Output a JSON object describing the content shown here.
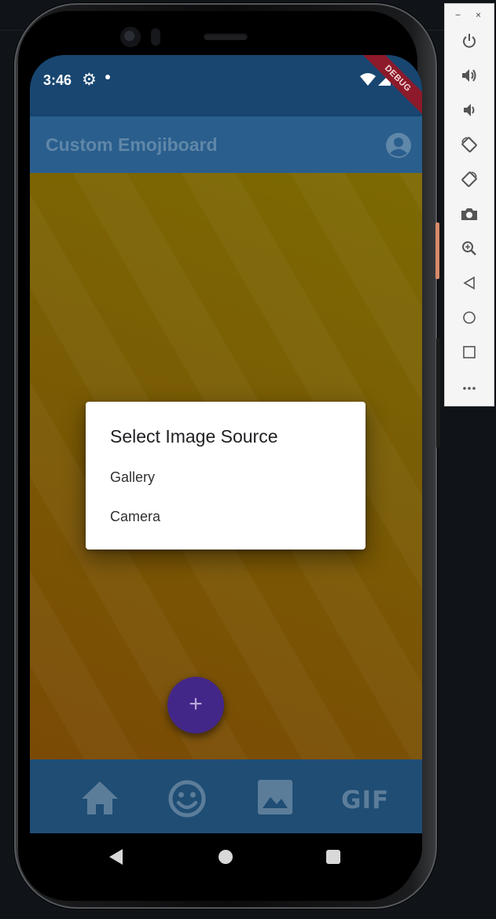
{
  "status_bar": {
    "time": "3:46",
    "debug_label": "DEBUG"
  },
  "app_bar": {
    "title": "Custom Emojiboard"
  },
  "bottom_nav": {
    "gif_label": "GIF"
  },
  "fab": {
    "label": "+"
  },
  "dialog": {
    "title": "Select Image Source",
    "options": [
      "Gallery",
      "Camera"
    ]
  },
  "emulator_toolbar": {
    "minimize": "−",
    "close": "×",
    "buttons": [
      "power-icon",
      "volume-up-icon",
      "volume-down-icon",
      "rotate-left-icon",
      "rotate-right-icon",
      "screenshot-icon",
      "zoom-icon",
      "back-icon",
      "home-icon",
      "overview-icon",
      "more-icon"
    ]
  },
  "colors": {
    "status_bar": "#184670",
    "app_bar": "#2a5e8c",
    "bottom_nav": "#1f4d74",
    "fab": "#432788",
    "content_background": "#7a5c04"
  }
}
